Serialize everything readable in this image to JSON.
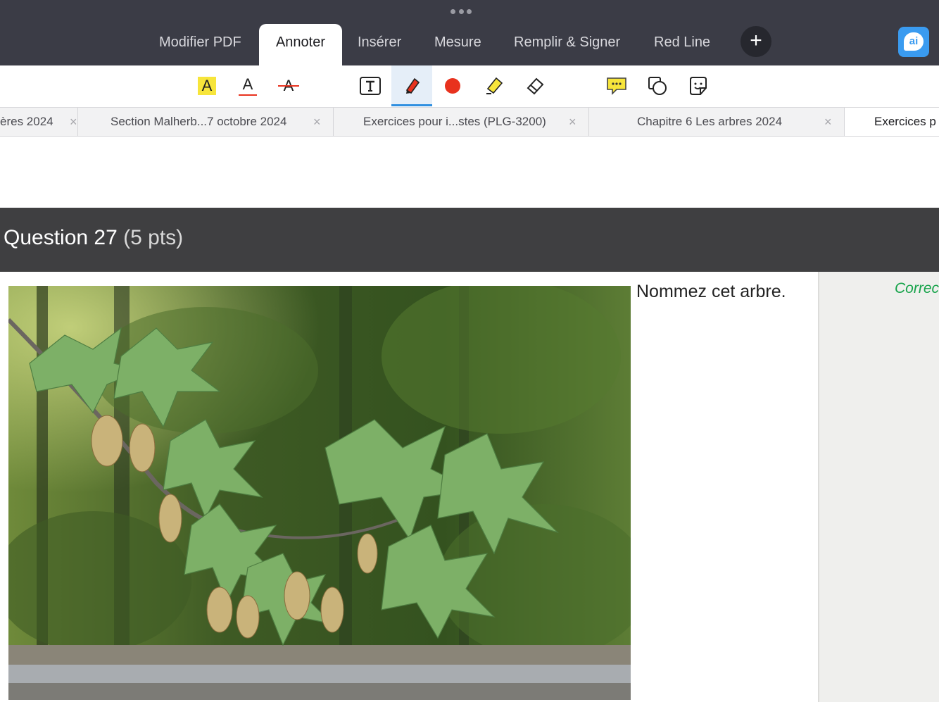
{
  "app": {
    "tabs": [
      {
        "label": "Modifier PDF"
      },
      {
        "label": "Annoter"
      },
      {
        "label": "Insérer"
      },
      {
        "label": "Mesure"
      },
      {
        "label": "Remplir & Signer"
      },
      {
        "label": "Red Line"
      }
    ],
    "active_tab": "Annoter",
    "add_label": "+",
    "ai_label": "ai"
  },
  "toolbar": {
    "tools": [
      {
        "icon": "highlight-text-icon",
        "glyph": "A"
      },
      {
        "icon": "underline-text-icon",
        "glyph": "A"
      },
      {
        "icon": "strikethrough-text-icon",
        "glyph": "A"
      },
      {
        "icon": "text-box-icon",
        "glyph": "T"
      },
      {
        "icon": "pen-icon",
        "selected": true
      },
      {
        "icon": "color-dot-icon"
      },
      {
        "icon": "highlighter-icon"
      },
      {
        "icon": "eraser-icon"
      },
      {
        "icon": "comment-icon"
      },
      {
        "icon": "shapes-icon"
      },
      {
        "icon": "sticker-icon"
      }
    ],
    "colors": {
      "pen": "#e8321e",
      "highlight": "#f7e53b",
      "accent": "#2f8fe0"
    }
  },
  "documents": [
    {
      "title": "ères 2024"
    },
    {
      "title": "Section Malherb...7 octobre 2024"
    },
    {
      "title": "Exercices pour i...stes (PLG-3200)"
    },
    {
      "title": "Chapitre 6 Les arbres  2024"
    },
    {
      "title": "Exercices p"
    }
  ],
  "close_glyph": "×",
  "question": {
    "title": "Question 27",
    "points": "(5 pts)",
    "prompt": "Nommez cet arbre."
  },
  "side_panel": {
    "text": "Correc"
  }
}
